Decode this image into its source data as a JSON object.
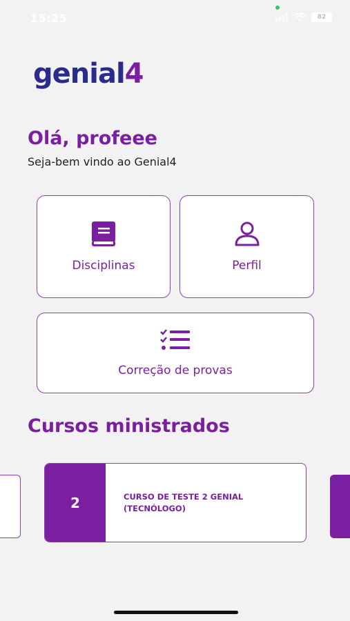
{
  "status": {
    "time": "15:25",
    "battery": "82"
  },
  "logo": {
    "text": "genial",
    "accent": "4"
  },
  "greeting": "Olá, profeee",
  "welcome": "Seja-bem vindo ao Genial4",
  "menu": {
    "disciplinas": {
      "label": "Disciplinas",
      "icon": "book-icon"
    },
    "perfil": {
      "label": "Perfil",
      "icon": "user-icon"
    },
    "correcao": {
      "label": "Correção de provas",
      "icon": "checklist-icon"
    }
  },
  "courses_section": {
    "title": "Cursos ministrados",
    "items": [
      {
        "number": "2",
        "name": "CURSO DE TESTE 2 GENIAL\n(TECNÓLOGO)"
      }
    ]
  },
  "colors": {
    "primary": "#7b1fa2",
    "logo": "#2b2b8c",
    "background": "#f2f2f2"
  }
}
